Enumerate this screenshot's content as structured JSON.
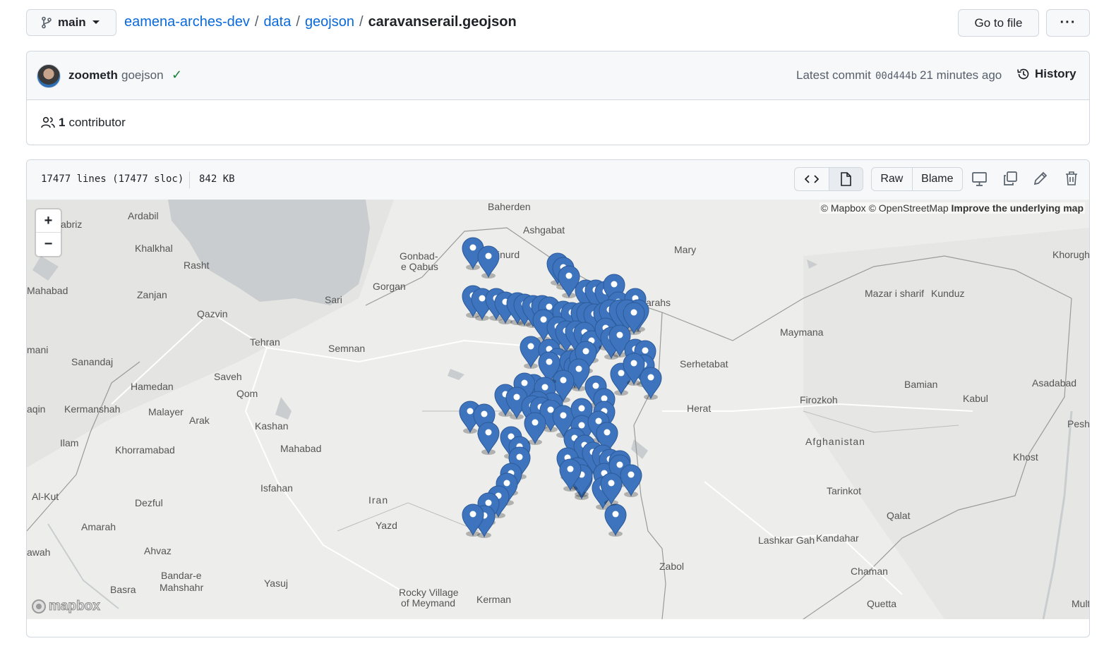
{
  "repo_nav": {
    "branch": "main",
    "breadcrumbs": [
      "eamena-arches-dev",
      "data",
      "geojson"
    ],
    "file_name": "caravanserail.geojson",
    "go_to_file": "Go to file",
    "more": "···"
  },
  "commit": {
    "author": "zoometh",
    "message": "goejson",
    "status": "✓",
    "latest_label": "Latest commit",
    "sha": "00d444b",
    "time": "21 minutes ago",
    "history": "History",
    "contributors_count": "1",
    "contributors_label": "contributor"
  },
  "file": {
    "lines": "17477 lines (17477 sloc)",
    "size": "842 KB",
    "raw": "Raw",
    "blame": "Blame"
  },
  "map": {
    "attribution": "© Mapbox © OpenStreetMap",
    "improve": "Improve the underlying map",
    "zoom_in": "+",
    "zoom_out": "−",
    "logo": "mapbox",
    "marker_color": "#3d74bd",
    "labels": {
      "baherden": "Baherden",
      "ashgabat": "Ashgabat",
      "mary": "Mary",
      "ardabil": "Ardabil",
      "tabriz": "abriz",
      "khalkhal": "Khalkhal",
      "rasht": "Rasht",
      "gonbad": "Gonbad-",
      "qabus": "e Qabus",
      "bojnurd": "jnurd",
      "mahabad": "Mahabad",
      "zanjan": "Zanjan",
      "gorgan": "Gorgan",
      "sari": "Sari",
      "sarakhs": "arahs",
      "qazvin": "Qazvin",
      "khorugh": "Khorugh",
      "mazar": "Mazar i sharif",
      "kunduz": "Kunduz",
      "maymana": "Maymana",
      "tehran": "Tehran",
      "semnan": "Semnan",
      "mani": "mani",
      "sanandaj": "Sanandaj",
      "serhetabat": "Serhetabat",
      "saveh": "Saveh",
      "qom": "Qom",
      "hamedan": "Hamedan",
      "bamian": "Bamian",
      "asadabad": "Asadabad",
      "kermanshah": "Kermanshah",
      "malayer": "Malayer",
      "aqin": "aqin",
      "herat": "Herat",
      "firozkoh": "Firozkoh",
      "kabul": "Kabul",
      "arak": "Arak",
      "kashan": "Kashan",
      "peshawar": "Peshawa",
      "ilam": "Ilam",
      "khorramabad": "Khorramabad",
      "mahabad2": "Mahabad",
      "afghanistan": "Afghanistan",
      "khost": "Khost",
      "isfahan": "Isfahan",
      "tarinkot": "Tarinkot",
      "alkut": "Al-Kut",
      "iran": "Iran",
      "dezful": "Dezful",
      "qalat": "Qalat",
      "amarah": "Amarah",
      "yazd": "Yazd",
      "ahvaz": "Ahvaz",
      "awah": "awah",
      "lashkargah": "Lashkar Gah",
      "kandahar": "Kandahar",
      "zabol": "Zabol",
      "bandare": "Bandar-e",
      "mahshahr": "Mahshahr",
      "chaman": "Chaman",
      "yasuj": "Yasuj",
      "basra": "Basra",
      "rocky": "Rocky Village",
      "meymand": "of Meymand",
      "kerman": "Kerman",
      "quetta": "Quetta",
      "multan": "Multan"
    }
  }
}
